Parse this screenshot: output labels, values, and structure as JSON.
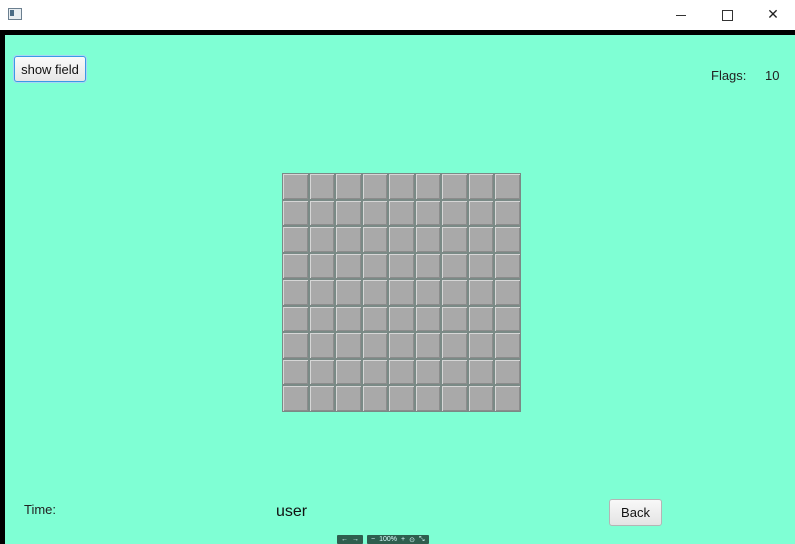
{
  "titlebar": {
    "app_icon": "window-app-icon",
    "minimize_glyph": "—",
    "maximize_glyph": "☐",
    "close_glyph": "✕"
  },
  "controls": {
    "show_field_label": "show field",
    "back_label": "Back"
  },
  "status": {
    "flags_label": "Flags:",
    "flags_value": "10",
    "time_label": "Time:",
    "user_label": "user"
  },
  "board": {
    "rows": 9,
    "cols": 9,
    "cell_state": "covered"
  },
  "zoom_toolbar": {
    "back": "←",
    "forward": "→",
    "zoom_out": "−",
    "zoom_level": "100%",
    "zoom_in": "+",
    "reset": "⊙",
    "fit": "⤡"
  },
  "colors": {
    "background": "#7fffd4",
    "cell": "#a9a9a9",
    "frame": "#000000"
  }
}
